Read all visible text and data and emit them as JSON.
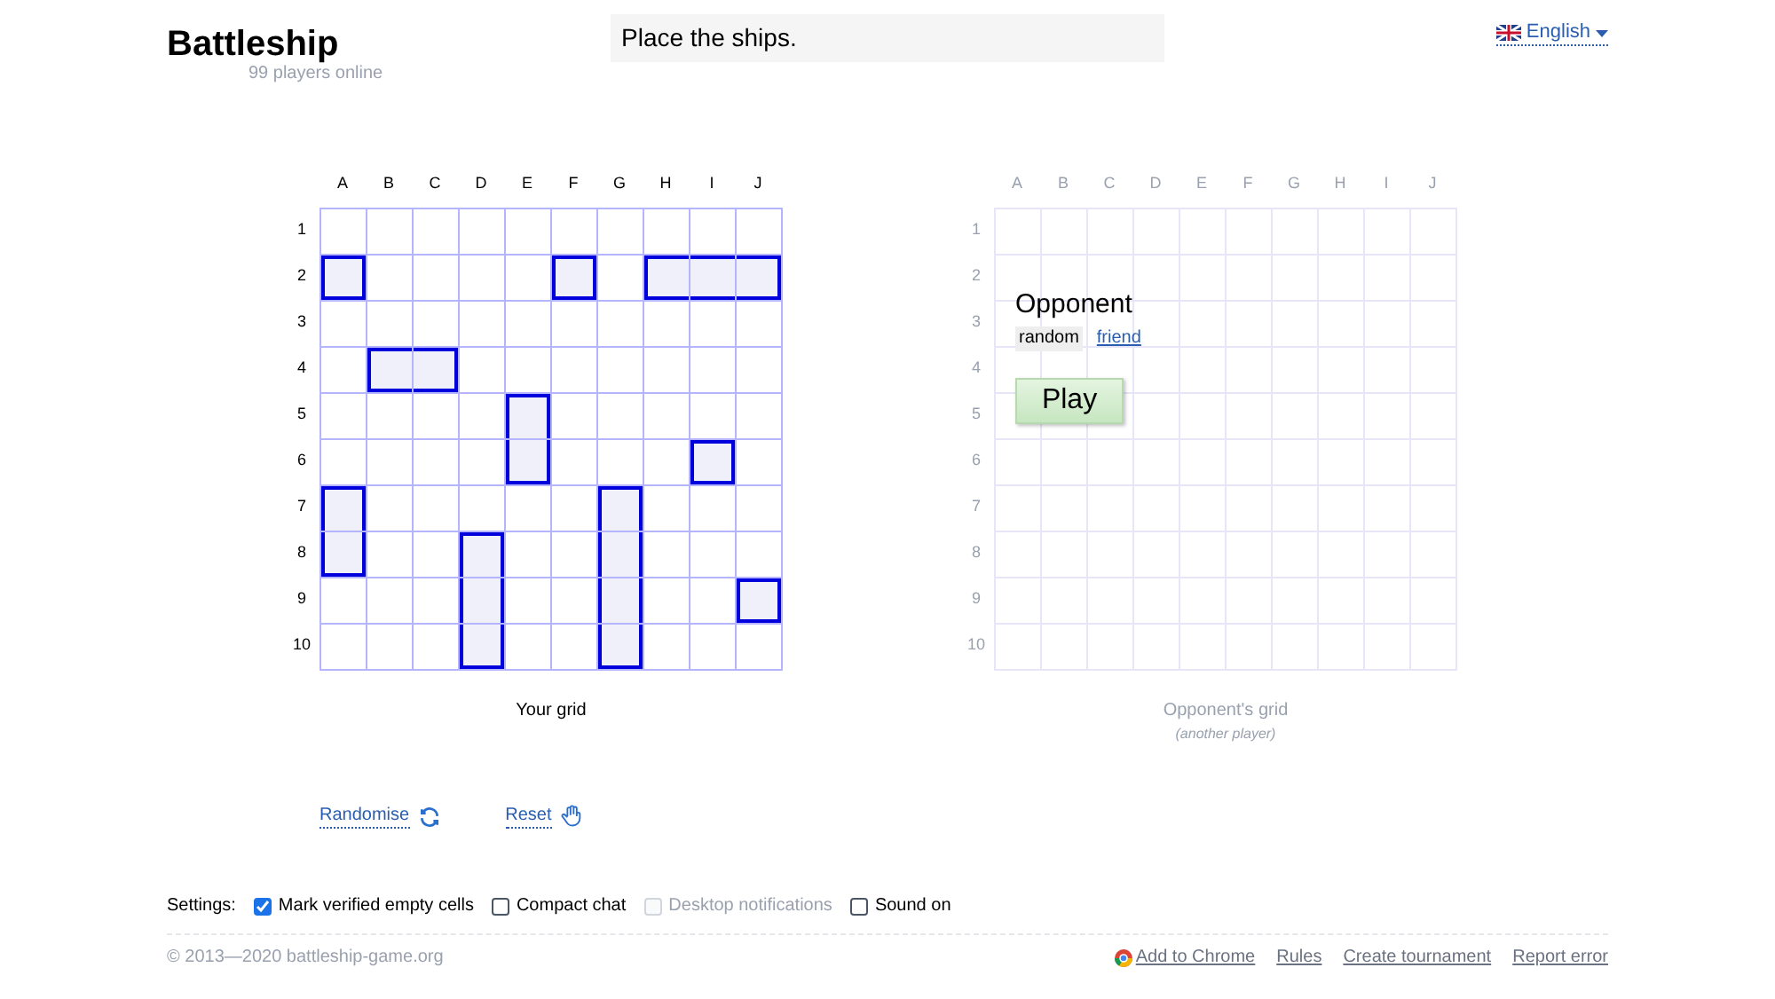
{
  "header": {
    "title": "Battleship",
    "online": "99 players online",
    "message": "Place the ships.",
    "language": "English"
  },
  "your_grid": {
    "columns": [
      "A",
      "B",
      "C",
      "D",
      "E",
      "F",
      "G",
      "H",
      "I",
      "J"
    ],
    "rows": [
      {
        "label": "1",
        "cells": [
          {
            "ship": false
          },
          {
            "ship": false
          },
          {
            "ship": false
          },
          {
            "ship": false
          },
          {
            "ship": false
          },
          {
            "ship": false
          },
          {
            "ship": false
          },
          {
            "ship": false
          },
          {
            "ship": false
          },
          {
            "ship": false
          }
        ]
      },
      {
        "label": "2",
        "cells": [
          {
            "ship": true
          },
          {
            "ship": false
          },
          {
            "ship": false
          },
          {
            "ship": false
          },
          {
            "ship": false
          },
          {
            "ship": true
          },
          {
            "ship": false
          },
          {
            "ship": true
          },
          {
            "ship": true
          },
          {
            "ship": true
          }
        ]
      },
      {
        "label": "3",
        "cells": [
          {
            "ship": false
          },
          {
            "ship": false
          },
          {
            "ship": false
          },
          {
            "ship": false
          },
          {
            "ship": false
          },
          {
            "ship": false
          },
          {
            "ship": false
          },
          {
            "ship": false
          },
          {
            "ship": false
          },
          {
            "ship": false
          }
        ]
      },
      {
        "label": "4",
        "cells": [
          {
            "ship": false
          },
          {
            "ship": true
          },
          {
            "ship": true
          },
          {
            "ship": false
          },
          {
            "ship": false
          },
          {
            "ship": false
          },
          {
            "ship": false
          },
          {
            "ship": false
          },
          {
            "ship": false
          },
          {
            "ship": false
          }
        ]
      },
      {
        "label": "5",
        "cells": [
          {
            "ship": false
          },
          {
            "ship": false
          },
          {
            "ship": false
          },
          {
            "ship": false
          },
          {
            "ship": true
          },
          {
            "ship": false
          },
          {
            "ship": false
          },
          {
            "ship": false
          },
          {
            "ship": false
          },
          {
            "ship": false
          }
        ]
      },
      {
        "label": "6",
        "cells": [
          {
            "ship": false
          },
          {
            "ship": false
          },
          {
            "ship": false
          },
          {
            "ship": false
          },
          {
            "ship": true
          },
          {
            "ship": false
          },
          {
            "ship": false
          },
          {
            "ship": false
          },
          {
            "ship": true
          },
          {
            "ship": false
          }
        ]
      },
      {
        "label": "7",
        "cells": [
          {
            "ship": true
          },
          {
            "ship": false
          },
          {
            "ship": false
          },
          {
            "ship": false
          },
          {
            "ship": false
          },
          {
            "ship": false
          },
          {
            "ship": true
          },
          {
            "ship": false
          },
          {
            "ship": false
          },
          {
            "ship": false
          }
        ]
      },
      {
        "label": "8",
        "cells": [
          {
            "ship": true
          },
          {
            "ship": false
          },
          {
            "ship": false
          },
          {
            "ship": true
          },
          {
            "ship": false
          },
          {
            "ship": false
          },
          {
            "ship": true
          },
          {
            "ship": false
          },
          {
            "ship": false
          },
          {
            "ship": false
          }
        ]
      },
      {
        "label": "9",
        "cells": [
          {
            "ship": false
          },
          {
            "ship": false
          },
          {
            "ship": false
          },
          {
            "ship": true
          },
          {
            "ship": false
          },
          {
            "ship": false
          },
          {
            "ship": true
          },
          {
            "ship": false
          },
          {
            "ship": false
          },
          {
            "ship": true
          }
        ]
      },
      {
        "label": "10",
        "cells": [
          {
            "ship": false
          },
          {
            "ship": false
          },
          {
            "ship": false
          },
          {
            "ship": true
          },
          {
            "ship": false
          },
          {
            "ship": false
          },
          {
            "ship": true
          },
          {
            "ship": false
          },
          {
            "ship": false
          },
          {
            "ship": false
          }
        ]
      }
    ],
    "caption": "Your grid"
  },
  "opponent_grid": {
    "columns": [
      "A",
      "B",
      "C",
      "D",
      "E",
      "F",
      "G",
      "H",
      "I",
      "J"
    ],
    "rows": [
      "1",
      "2",
      "3",
      "4",
      "5",
      "6",
      "7",
      "8",
      "9",
      "10"
    ],
    "caption": "Opponent's grid",
    "subcaption": "(another player)"
  },
  "opponent_panel": {
    "title": "Opponent",
    "options": [
      {
        "label": "random",
        "selected": true
      },
      {
        "label": "friend",
        "selected": false
      }
    ],
    "play": "Play"
  },
  "actions": [
    {
      "label": "Randomise",
      "kind": "randomise"
    },
    {
      "label": "Reset",
      "kind": "reset"
    }
  ],
  "settings": {
    "label": "Settings:",
    "items": [
      {
        "label": "Mark verified empty cells",
        "checked": true,
        "disabled": false
      },
      {
        "label": "Compact chat",
        "checked": false,
        "disabled": false
      },
      {
        "label": "Desktop notifications",
        "checked": false,
        "disabled": true
      },
      {
        "label": "Sound on",
        "checked": false,
        "disabled": false
      }
    ]
  },
  "footer": {
    "copyright": "© 2013—2020 battleship-game.org",
    "links": [
      {
        "label": "Add to Chrome",
        "kind": "chrome"
      },
      {
        "label": "Rules",
        "kind": "plain"
      },
      {
        "label": "Create tournament",
        "kind": "plain"
      },
      {
        "label": "Report error",
        "kind": "plain"
      }
    ]
  }
}
